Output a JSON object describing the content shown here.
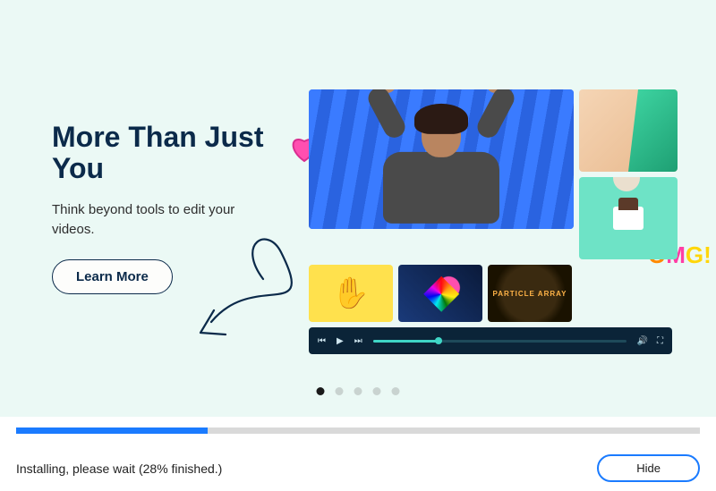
{
  "hero": {
    "title": "More Than Just You",
    "subtitle": "Think beyond tools to edit your videos.",
    "cta_label": "Learn More"
  },
  "collage": {
    "thumb3_label": "PARTICLE ARRAY"
  },
  "player": {
    "progress_pct": 26
  },
  "carousel": {
    "active_index": 0,
    "dot_count": 5
  },
  "install": {
    "progress_pct": 28,
    "status_text": "Installing, please wait (28% finished.)",
    "hide_label": "Hide"
  }
}
